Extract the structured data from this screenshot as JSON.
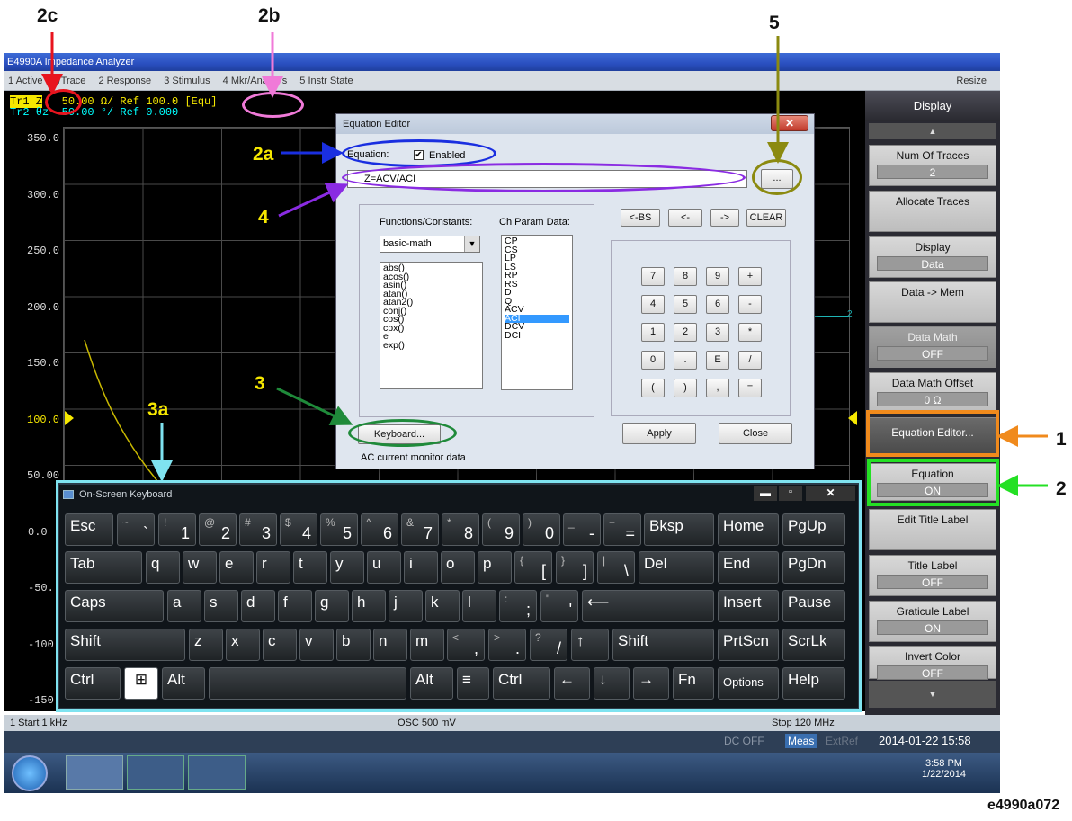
{
  "callouts": {
    "c2c": "2c",
    "c2b": "2b",
    "c5": "5",
    "c2a": "2a",
    "c4": "4",
    "c3": "3",
    "c3a": "3a",
    "c1": "1",
    "c2": "2",
    "caption": "e4990a072"
  },
  "window": {
    "title": "E4990A Impedance Analyzer",
    "menus": [
      "1 Active Ch/Trace",
      "2 Response",
      "3 Stimulus",
      "4 Mkr/Analysis",
      "5 Instr State"
    ],
    "resize": "Resize"
  },
  "traces": {
    "tr1": "Tr1 Z",
    "tr1_scale": "50.00 Ω/ Ref 100.0",
    "equ": "[Equ]",
    "tr2": "Tr2 θz",
    "tr2_scale": "50.00 °/ Ref 0.000"
  },
  "y_labels": [
    "350.0",
    "300.0",
    "250.0",
    "200.0",
    "150.0",
    "100.0",
    "50.00",
    "0.0",
    "-50.",
    "-100",
    "-150"
  ],
  "trace_marker": "2",
  "softkeys": {
    "title": "Display",
    "items": [
      {
        "label": "Num Of Traces",
        "value": "2"
      },
      {
        "label": "Allocate Traces",
        "value": ""
      },
      {
        "label": "Display",
        "value": "Data"
      },
      {
        "label": "Data -> Mem",
        "value": ""
      },
      {
        "label": "Data Math",
        "value": "OFF"
      },
      {
        "label": "Data Math Offset",
        "value": "0 Ω"
      },
      {
        "label": "Equation Editor...",
        "value": ""
      },
      {
        "label": "Equation",
        "value": "ON"
      },
      {
        "label": "Edit Title Label",
        "value": ""
      },
      {
        "label": "Title Label",
        "value": "OFF"
      },
      {
        "label": "Graticule Label",
        "value": "ON"
      },
      {
        "label": "Invert Color",
        "value": "OFF"
      }
    ]
  },
  "dialog": {
    "title": "Equation Editor",
    "eq_label": "Equation:",
    "enabled_label": "Enabled",
    "equation_value": "Z=ACV/ACI",
    "browse": "...",
    "func_label": "Functions/Constants:",
    "func_select": "basic-math",
    "functions": [
      "abs()",
      "acos()",
      "asin()",
      "atan()",
      "atan2()",
      "conj()",
      "cos()",
      "cpx()",
      "e",
      "exp()"
    ],
    "param_label": "Ch Param Data:",
    "params": [
      "CP",
      "CS",
      "LP",
      "LS",
      "RP",
      "RS",
      "D",
      "Q",
      "ACV",
      "ACI",
      "DCV",
      "DCI"
    ],
    "selected_param": "ACI",
    "edit_buttons": [
      "<-BS",
      "<-",
      "->",
      "CLEAR"
    ],
    "keypad": [
      "7",
      "8",
      "9",
      "+",
      "4",
      "5",
      "6",
      "-",
      "1",
      "2",
      "3",
      "*",
      "0",
      ".",
      "E",
      "/",
      "(",
      ")",
      ",",
      "="
    ],
    "keyboard_btn": "Keyboard...",
    "apply": "Apply",
    "close": "Close",
    "status": "AC current monitor data"
  },
  "osk": {
    "title": "On-Screen Keyboard"
  },
  "status": {
    "start": "1 Start 1 kHz",
    "osc": "OSC 500 mV",
    "stop": "Stop 120 MHz",
    "dcoff": "DC OFF",
    "meas": "Meas",
    "extref": "ExtRef",
    "datetime": "2014-01-22 15:58"
  },
  "taskbar": {
    "time": "3:58 PM",
    "date": "1/22/2014"
  },
  "colors": {
    "red": "#e8141e",
    "pink": "#f07ad8",
    "blue": "#1a2fe0",
    "purple": "#8a2be2",
    "green": "#1f8a3a",
    "olive": "#8b8a10",
    "cyan": "#7fe3f0",
    "orange": "#f08a1c",
    "bright_green": "#24e024",
    "yellow": "#f6e800"
  }
}
